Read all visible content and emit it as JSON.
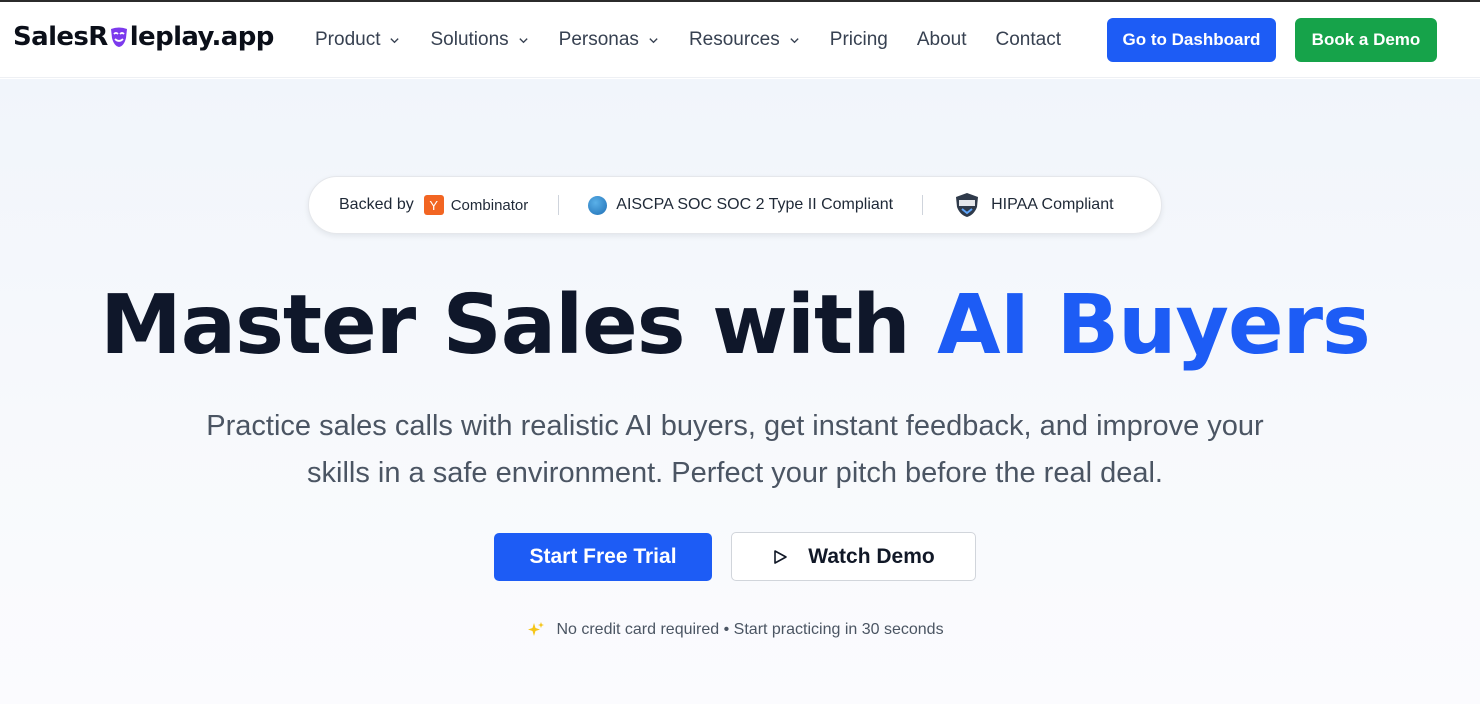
{
  "brand": {
    "name_prefix": "SalesR",
    "name_suffix": "leplay.app"
  },
  "nav": {
    "items": [
      {
        "label": "Product",
        "has_dropdown": true
      },
      {
        "label": "Solutions",
        "has_dropdown": true
      },
      {
        "label": "Personas",
        "has_dropdown": true
      },
      {
        "label": "Resources",
        "has_dropdown": true
      },
      {
        "label": "Pricing",
        "has_dropdown": false
      },
      {
        "label": "About",
        "has_dropdown": false
      },
      {
        "label": "Contact",
        "has_dropdown": false
      }
    ],
    "dashboard_button": "Go to Dashboard",
    "demo_button": "Book a Demo"
  },
  "badges": {
    "backed_by": "Backed by",
    "yc_letter": "Y",
    "yc_name": "Combinator",
    "soc": "AISCPA SOC SOC 2 Type II Compliant",
    "hipaa": "HIPAA Compliant"
  },
  "hero": {
    "title_main": "Master Sales with ",
    "title_accent": "AI Buyers",
    "subtitle": "Practice sales calls with realistic AI buyers, get instant feedback, and improve your skills in a safe environment. Perfect your pitch before the real deal.",
    "primary_cta": "Start Free Trial",
    "secondary_cta": "Watch Demo",
    "note": "No credit card required • Start practicing in 30 seconds"
  },
  "colors": {
    "primary": "#1d5cf5",
    "success": "#16a34a",
    "yc_orange": "#f26522",
    "heading": "#0f172a",
    "mask_purple": "#7c3aed"
  },
  "icons": [
    "theater-mask-icon",
    "chevron-down-icon",
    "yc-logo-icon",
    "aicpa-seal-icon",
    "hipaa-shield-icon",
    "play-icon",
    "sparkle-icon"
  ]
}
